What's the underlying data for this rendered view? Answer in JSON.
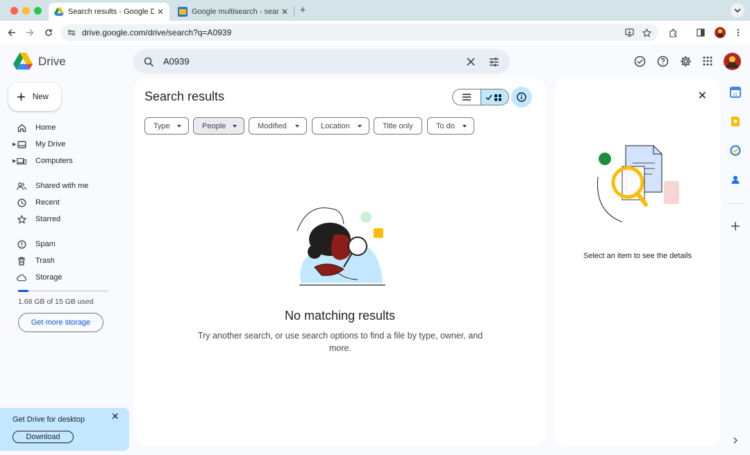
{
  "browser": {
    "tabs": [
      {
        "title": "Search results - Google Drive",
        "active": true
      },
      {
        "title": "Google multisearch - search i",
        "active": false
      }
    ],
    "url": "drive.google.com/drive/search?q=A0939"
  },
  "header": {
    "app_name": "Drive",
    "search_query": "A0939"
  },
  "sidebar": {
    "new_label": "New",
    "items": [
      {
        "label": "Home",
        "icon": "home-icon"
      },
      {
        "label": "My Drive",
        "icon": "my-drive-icon"
      },
      {
        "label": "Computers",
        "icon": "computers-icon"
      },
      {
        "label": "Shared with me",
        "icon": "shared-icon"
      },
      {
        "label": "Recent",
        "icon": "clock-icon"
      },
      {
        "label": "Starred",
        "icon": "star-icon"
      },
      {
        "label": "Spam",
        "icon": "spam-icon"
      },
      {
        "label": "Trash",
        "icon": "trash-icon"
      },
      {
        "label": "Storage",
        "icon": "cloud-icon"
      }
    ],
    "storage_used_fraction": 0.112,
    "storage_text": "1.68 GB of 15 GB used",
    "get_storage_label": "Get more storage"
  },
  "promo": {
    "title": "Get Drive for desktop",
    "button": "Download"
  },
  "main": {
    "title": "Search results",
    "filters": [
      "Type",
      "People",
      "Modified",
      "Location",
      "Title only",
      "To do"
    ],
    "empty_title": "No matching results",
    "empty_subtitle": "Try another search, or use search options to find a file by type, owner, and more."
  },
  "details": {
    "message": "Select an item to see the details"
  },
  "colors": {
    "accent": "#0b57d0",
    "selected_bg": "#c2e7ff",
    "search_bg": "#e9eef6",
    "page_bg": "#f8fafd"
  }
}
